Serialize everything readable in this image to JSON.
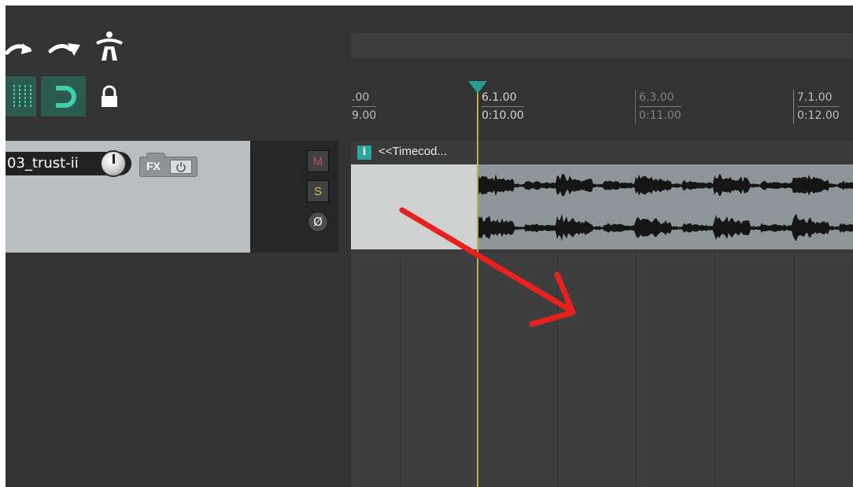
{
  "toolbar": {
    "icons": [
      "undo-icon",
      "redo-icon",
      "ripple-edit-icon",
      "grid-icon",
      "snap-icon",
      "lock-icon"
    ],
    "accent_color": "#2aa6a0"
  },
  "track": {
    "name": "03_trust-ii",
    "fx_label": "FX",
    "mute_label": "M",
    "solo_label": "S",
    "phase_label": "Ø",
    "panel_color": "#b9bec0"
  },
  "ruler": {
    "ticks": [
      {
        "bar": ".00",
        "time": "9.00"
      },
      {
        "bar": "6.1.00",
        "time": "0:10.00"
      },
      {
        "bar": "6.3.00",
        "time": "0:11.00"
      },
      {
        "bar": "7.1.00",
        "time": "0:12.00"
      }
    ]
  },
  "item": {
    "name": "<<Timecod...",
    "info_icon": "i",
    "color": "#8c9699"
  },
  "playhead": {
    "color": "#b8b24a"
  },
  "annotation": {
    "arrow_color": "#e8201e",
    "icon": "red-arrow-annotation"
  }
}
